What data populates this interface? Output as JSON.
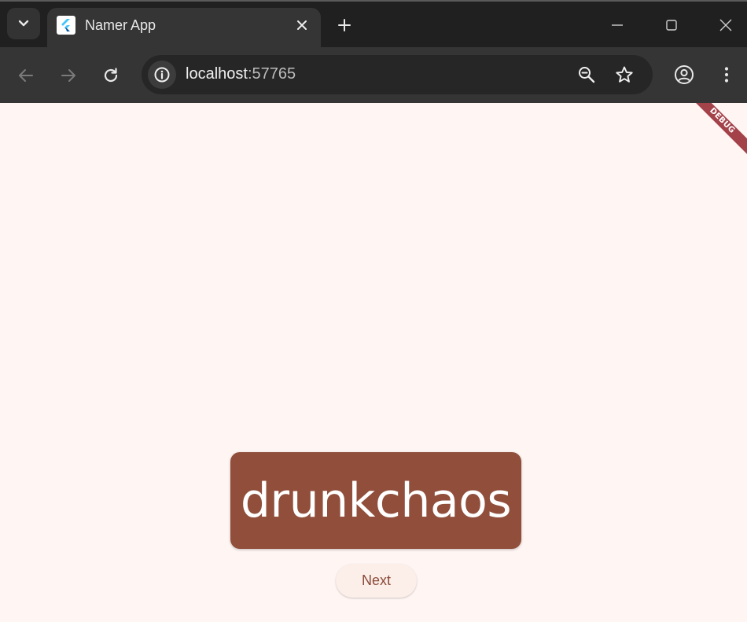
{
  "browser": {
    "tab": {
      "title": "Namer App",
      "favicon": "flutter-logo"
    },
    "address_bar": {
      "host": "localhost",
      "port": ":57765"
    },
    "icons": {
      "tab_search": "chevron-down-icon",
      "tab_close": "close-icon",
      "new_tab": "plus-icon",
      "minimize": "minimize-icon",
      "maximize": "maximize-icon",
      "close_window": "close-icon",
      "back": "arrow-left-icon",
      "forward": "arrow-right-icon",
      "reload": "reload-icon",
      "site_info": "info-icon",
      "zoom": "zoom-out-icon",
      "bookmark": "star-icon",
      "profile": "account-icon",
      "menu": "more-vert-icon"
    }
  },
  "app": {
    "debug_banner": "DEBUG",
    "word_pair": "drunkchaos",
    "next_label": "Next"
  },
  "colors": {
    "page_background": "#fff6f4",
    "card_background": "#904e3b",
    "card_text": "#ffffff",
    "button_background": "#fceee9",
    "button_text": "#8a4a37",
    "debug_banner": "#a4424a"
  }
}
